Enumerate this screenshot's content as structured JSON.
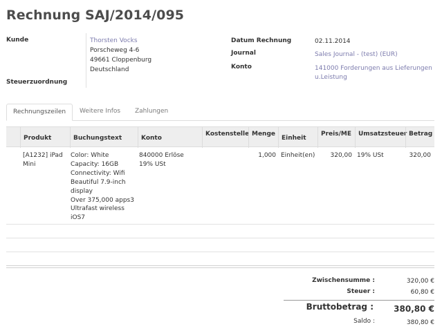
{
  "header": {
    "title_prefix": "Rechnung",
    "title_number": "SAJ/2014/095"
  },
  "fields": {
    "kunde_label": "Kunde",
    "kunde_name": "Thorsten Vocks",
    "kunde_street": "Porscheweg 4-6",
    "kunde_city": "49661 Cloppenburg",
    "kunde_country": "Deutschland",
    "steuer_label": "Steuerzuordnung",
    "datum_label": "Datum Rechnung",
    "datum_value": "02.11.2014",
    "journal_label": "Journal",
    "journal_value": "Sales Journal - (test) (EUR)",
    "konto_label": "Konto",
    "konto_value_1": "141000 Forderungen aus Lieferungen",
    "konto_value_2": "u.Leistung"
  },
  "tabs": [
    {
      "label": "Rechnungszeilen",
      "active": true
    },
    {
      "label": "Weitere Infos",
      "active": false
    },
    {
      "label": "Zahlungen",
      "active": false
    }
  ],
  "table": {
    "headers": {
      "produkt": "Produkt",
      "buchungstext": "Buchungstext",
      "konto": "Konto",
      "kostenstelle": "Kostenstelle",
      "menge": "Menge",
      "einheit": "Einheit",
      "preis": "Preis/ME",
      "umsatzsteuer": "Umsatzsteuer",
      "betrag": "Betrag"
    },
    "row": {
      "produkt_1": "[A1232] iPad",
      "produkt_2": "Mini",
      "buch_1": "Color: White",
      "buch_2": "Capacity: 16GB",
      "buch_3": "Connectivity: Wifi",
      "buch_4": "Beautiful 7.9-inch",
      "buch_5": "display",
      "buch_6": "Over 375,000 apps3",
      "buch_7": "Ultrafast wireless",
      "buch_8": "iOS7",
      "konto_1": "840000 Erlöse",
      "konto_2": "19% USt",
      "menge": "1,000",
      "einheit": "Einheit(en)",
      "preis": "320,00",
      "steuer": "19% USt",
      "betrag": "320,00"
    }
  },
  "totals": {
    "zwischensumme_label": "Zwischensumme :",
    "zwischensumme_value": "320,00 €",
    "steuer_label": "Steuer :",
    "steuer_value": "60,80 €",
    "brutto_label": "Bruttobetrag :",
    "brutto_value": "380,80 €",
    "saldo_label": "Saldo :",
    "saldo_value": "380,80 €"
  }
}
